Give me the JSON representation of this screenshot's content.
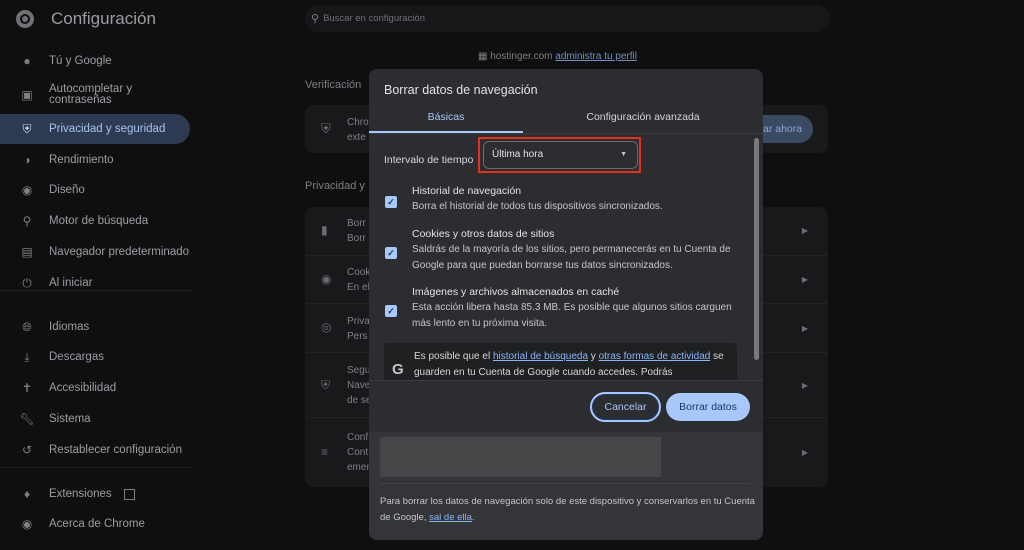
{
  "header": {
    "title": "Configuración",
    "search_placeholder": "Buscar en configuración"
  },
  "sidebar": {
    "items": [
      {
        "label": "Tú y Google",
        "icon": "person-icon"
      },
      {
        "label": "Autocompletar y contraseñas",
        "icon": "clipboard-icon"
      },
      {
        "label": "Privacidad y seguridad",
        "icon": "shield-icon",
        "active": true
      },
      {
        "label": "Rendimiento",
        "icon": "speedometer-icon"
      },
      {
        "label": "Diseño",
        "icon": "palette-icon"
      },
      {
        "label": "Motor de búsqueda",
        "icon": "search-icon"
      },
      {
        "label": "Navegador predeterminado",
        "icon": "browser-icon"
      },
      {
        "label": "Al iniciar",
        "icon": "power-icon"
      },
      {
        "label": "Idiomas",
        "icon": "globe-icon"
      },
      {
        "label": "Descargas",
        "icon": "download-icon"
      },
      {
        "label": "Accesibilidad",
        "icon": "accessibility-icon"
      },
      {
        "label": "Sistema",
        "icon": "wrench-icon"
      },
      {
        "label": "Restablecer configuración",
        "icon": "history-icon"
      },
      {
        "label": "Extensiones",
        "icon": "puzzle-icon"
      },
      {
        "label": "Acerca de Chrome",
        "icon": "chrome-icon"
      }
    ]
  },
  "managed": {
    "domain": "hostinger.com",
    "link": "administra tu perfil"
  },
  "main": {
    "section1_title": "Verificación",
    "check_card": {
      "line1": "Chro",
      "line2": "exte",
      "button": "ar ahora"
    },
    "section2_title": "Privacidad y",
    "rows": [
      {
        "line1": "Borr",
        "line2": "Borr",
        "line3": ""
      },
      {
        "line1": "Cook",
        "line2": "En el",
        "line3": ""
      },
      {
        "line1": "Priva",
        "line2": "Pers",
        "line3": ""
      },
      {
        "line1": "Segu",
        "line2": "Nave",
        "line3": "de se"
      },
      {
        "line1": "Conf",
        "line2": "Cont",
        "line3": "emer"
      }
    ]
  },
  "dialog": {
    "title": "Borrar datos de navegación",
    "tabs": [
      {
        "label": "Básicas",
        "active": true
      },
      {
        "label": "Configuración avanzada"
      }
    ],
    "time_range_label": "Intervalo de tiempo",
    "time_range_value": "Última hora",
    "options": [
      {
        "title": "Historial de navegación",
        "desc": "Borra el historial de todos tus dispositivos sincronizados.",
        "checked": true
      },
      {
        "title": "Cookies y otros datos de sitios",
        "desc": "Saldrás de la mayoría de los sitios, pero permanecerás en tu Cuenta de Google para que puedan borrarse tus datos sincronizados.",
        "checked": true
      },
      {
        "title": "Imágenes y archivos almacenados en caché",
        "desc": "Esta acción libera hasta 85.3 MB. Es posible que algunos sitios carguen más lento en tu próxima visita.",
        "checked": true
      }
    ],
    "info": {
      "pre": "Es posible que el ",
      "link1": "historial de búsqueda",
      "mid": " y ",
      "link2": "otras formas de actividad",
      "post": " se guarden en tu Cuenta de Google cuando accedes. Podrás"
    },
    "cancel": "Cancelar",
    "confirm": "Borrar datos",
    "footer": {
      "pre": "Para borrar los datos de navegación solo de este dispositivo y conservarlos en tu Cuenta de Google, ",
      "link": "sal de ella",
      "post": "."
    }
  },
  "colors": {
    "accent": "#a8c7fa",
    "highlight": "#e0321f"
  }
}
